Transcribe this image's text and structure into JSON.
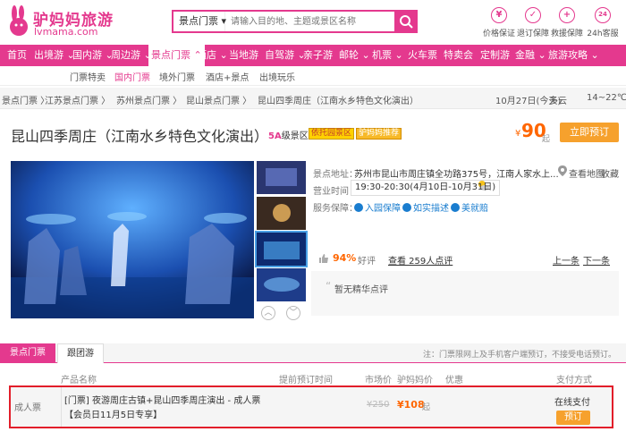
{
  "brand": {
    "name_cn": "驴妈妈旅游",
    "name_en": "lvmama.com",
    "color": "#e4398e"
  },
  "search": {
    "category": "景点门票",
    "placeholder": "请输入目的地、主题或景区名称"
  },
  "guarantees": [
    {
      "icon": "yen-shield-icon",
      "glyph": "¥",
      "label": "价格保证"
    },
    {
      "icon": "refund-shield-icon",
      "glyph": "✓",
      "label": "退订保障"
    },
    {
      "icon": "rescue-shield-icon",
      "glyph": "+",
      "label": "救援保障"
    },
    {
      "icon": "service-clock-icon",
      "glyph": "24",
      "label": "24h客服"
    }
  ],
  "nav": [
    {
      "label": "首页"
    },
    {
      "label": "出境游 ⌄"
    },
    {
      "label": "国内游 ⌄"
    },
    {
      "label": "周边游 ⌄"
    },
    {
      "label": "景点门票 ⌃"
    },
    {
      "label": "酒店 ⌄"
    },
    {
      "label": "当地游"
    },
    {
      "label": "自驾游 ⌄"
    },
    {
      "label": "亲子游"
    },
    {
      "label": "邮轮 ⌄"
    },
    {
      "label": "机票 ⌄"
    },
    {
      "label": "火车票"
    },
    {
      "label": "特卖会"
    },
    {
      "label": "定制游"
    },
    {
      "label": "金融 ⌄"
    },
    {
      "label": "旅游攻略 ⌄"
    }
  ],
  "subnav": [
    "门票特卖",
    "国内门票",
    "境外门票",
    "酒店+景点",
    "出境玩乐"
  ],
  "breadcrumb": [
    "景点门票 〉",
    "江苏景点门票 〉",
    "苏州景点门票 〉",
    "昆山景点门票 〉",
    "昆山四季周庄（江南水乡特色文化演出）"
  ],
  "weather": {
    "date": "10月27日(今天)",
    "condition": "多云",
    "temp": "14~22℃"
  },
  "product": {
    "title": "昆山四季周庄（江南水乡特色文化演出）",
    "level_grade": "5A",
    "level_suffix": "级景区",
    "badges": [
      "依托园景区",
      "驴妈妈推荐"
    ],
    "price_symbol": "¥",
    "price": "90",
    "price_suffix": "起",
    "book_label": "立即预订"
  },
  "info": {
    "address_label": "景点地址：",
    "address": "苏州市昆山市周庄镇全功路375号，江南人家水上...",
    "map_link": "查看地图",
    "favorite": "收藏",
    "hours_label": "营业时间",
    "hours": "19:30-20:30(4月10日-10月31日)",
    "service_label": "服务保障：",
    "services": [
      "入园保障",
      "如实描述",
      "美就赔"
    ]
  },
  "reviews": {
    "rate": "94%",
    "rate_label": "好评",
    "count_link": "查看 259人点评",
    "prev": "上一条",
    "next": "下一条",
    "empty_text": "暂无精华点评"
  },
  "tabs": [
    "景点门票",
    "跟团游"
  ],
  "tab_note": "注：门票限网上及手机客户端预订，不接受电话预订。",
  "columns": [
    "产品名称",
    "提前预订时间",
    "市场价",
    "驴妈妈价",
    "优惠",
    "支付方式"
  ],
  "ticket": {
    "type": "成人票",
    "name": "[门票] 夜游周庄古镇+昆山四季周庄演出 - 成人票",
    "promo": "【会员日11月5日专享】",
    "market_price": "¥250",
    "price_symbol": "¥",
    "price": "108",
    "price_suffix": "起",
    "payment": "在线支付",
    "book_label": "预订"
  }
}
